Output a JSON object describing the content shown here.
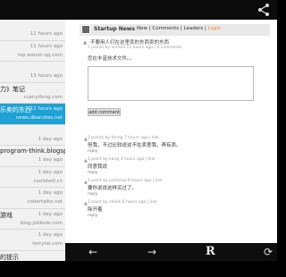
{
  "sidebar": {
    "items": [
      {
        "title": "",
        "meta": "11 hours ago"
      },
      {
        "title": "",
        "meta": "mp.weixin.qq.com",
        "right": "11 hours ago"
      },
      {
        "title": "",
        "meta": "13 hours ago"
      },
      {
        "title": "力》笔记",
        "meta": "ruanyifeng.com"
      },
      {
        "title": "乐卖的东西",
        "meta": "news.dbanotes.net",
        "right": "11 hours ago",
        "selected": true
      },
      {
        "title": "",
        "meta": "1 day ago"
      },
      {
        "title": "program-think.blogspot.com",
        "meta": "1 day ago"
      },
      {
        "title": "",
        "meta": "coolshell.cn",
        "right": "1 day ago"
      },
      {
        "title": "",
        "meta": "codertalks.net",
        "right": "1 day ago"
      },
      {
        "title": "游戏",
        "meta": "blog.jobbole.com",
        "right": "1 day ago"
      },
      {
        "title": "",
        "meta": "terrytai.com",
        "right": "1 day ago"
      },
      {
        "title": "的提示",
        "meta": ""
      }
    ]
  },
  "web": {
    "hn_title": "Startup News",
    "nav": {
      "new": "New",
      "comments": "Comments",
      "leaders": "Leaders",
      "login": "Login"
    },
    "story_title": "不要用人们在这里卖的东西卖的东西",
    "story_meta": "7 points by ximeta 11 hours ago | 4 comments",
    "story_text": "您在丰富技术文件。。",
    "add_comment": "add comment",
    "comments": [
      {
        "meta": "2 points by fenng 7 hours ago | link",
        "text": "但我，不过比较说这不在卖意我，再有卖。",
        "reply": "reply"
      },
      {
        "meta": "1 point by kang 3 hours ago | link",
        "text": "同意我说",
        "reply": "reply"
      },
      {
        "meta": "1 point by justinluo 6 hours ago | link",
        "text": "要你说说这样买过了。",
        "reply": "reply"
      },
      {
        "meta": "1 point by shelik 8 hours ago | link",
        "text": "除开着",
        "reply": "reply"
      }
    ]
  },
  "toolbar": {
    "back": "←",
    "forward": "→",
    "readability": "R",
    "refresh": "⟳"
  }
}
